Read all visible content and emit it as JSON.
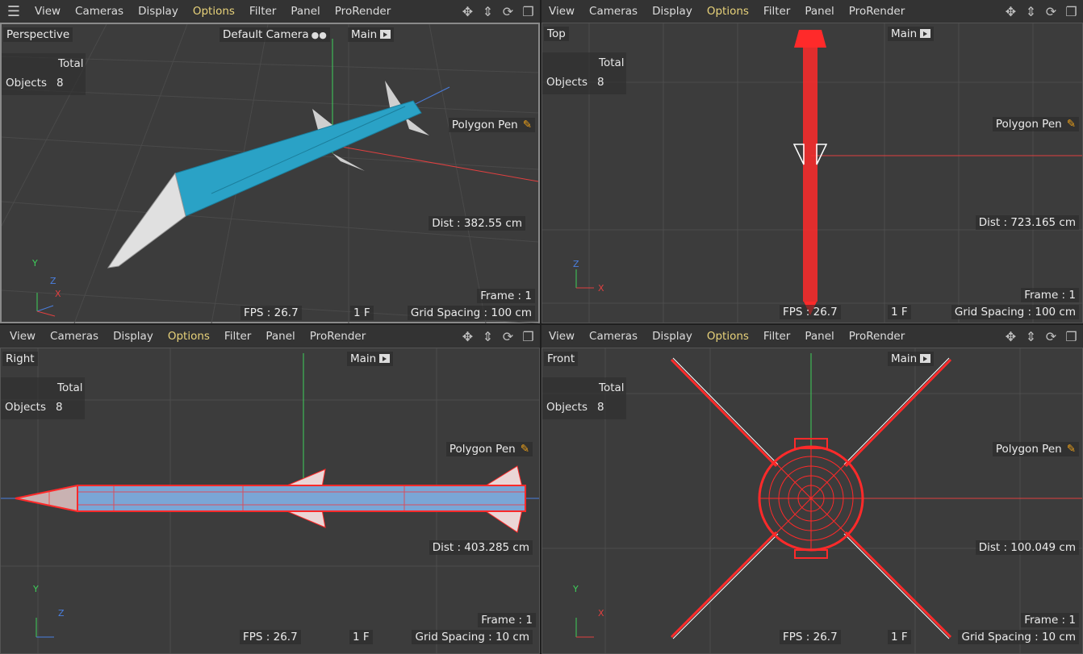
{
  "menu": {
    "view": "View",
    "cameras": "Cameras",
    "display": "Display",
    "options": "Options",
    "filter": "Filter",
    "panel": "Panel",
    "prorender": "ProRender"
  },
  "nav_icons": [
    "move-view-icon",
    "dolly-view-icon",
    "rotate-view-icon",
    "maximize-view-icon"
  ],
  "stats": {
    "header": "Total",
    "label": "Objects",
    "value": "8"
  },
  "tool": "Polygon Pen",
  "take": "Main",
  "colors": {
    "viewport_bg": "#3c3c3c",
    "menu_bg": "#333333",
    "options_active": "#e8d27a",
    "missile_body": "#2aa2c6",
    "wire_red": "#ff2a2a",
    "x_axis": "#e04040",
    "y_axis": "#3ecf5a",
    "z_axis": "#4a7fe0"
  },
  "viewports": [
    {
      "name": "Perspective",
      "camera": "Default Camera",
      "dist": "Dist : 382.55 cm",
      "frame": "Frame : 1",
      "fps": "FPS : 26.7",
      "f": "1 F",
      "grid": "Grid Spacing : 100 cm",
      "axes": {
        "a": "Y",
        "b": "Z",
        "c": "X"
      }
    },
    {
      "name": "Top",
      "dist": "Dist : 723.165 cm",
      "frame": "Frame : 1",
      "fps": "FPS : 26.7",
      "f": "1 F",
      "grid": "Grid Spacing : 100 cm",
      "axes": {
        "a": "Z",
        "b": "X"
      }
    },
    {
      "name": "Right",
      "dist": "Dist : 403.285 cm",
      "frame": "Frame : 1",
      "fps": "FPS : 26.7",
      "f": "1 F",
      "grid": "Grid Spacing : 10 cm",
      "axes": {
        "a": "Y",
        "b": "Z"
      }
    },
    {
      "name": "Front",
      "dist": "Dist : 100.049 cm",
      "frame": "Frame : 1",
      "fps": "FPS : 26.7",
      "f": "1 F",
      "grid": "Grid Spacing : 10 cm",
      "axes": {
        "a": "Y",
        "b": "X"
      }
    }
  ]
}
